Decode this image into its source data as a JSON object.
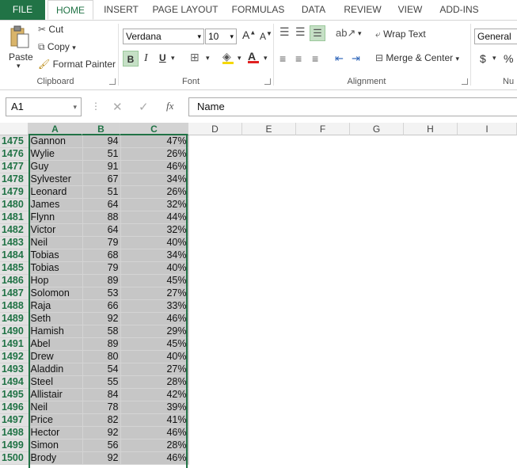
{
  "tabs": [
    "FILE",
    "HOME",
    "INSERT",
    "PAGE LAYOUT",
    "FORMULAS",
    "DATA",
    "REVIEW",
    "VIEW",
    "ADD-INS"
  ],
  "clipboard": {
    "paste": "Paste",
    "cut": "Cut",
    "copy": "Copy",
    "format_painter": "Format Painter",
    "label": "Clipboard"
  },
  "font": {
    "name": "Verdana",
    "size": "10",
    "bold": "B",
    "italic": "I",
    "underline": "U",
    "label": "Font",
    "font_color": "#e02020"
  },
  "alignment": {
    "wrap_text": "Wrap Text",
    "merge_center": "Merge & Center",
    "label": "Alignment"
  },
  "number": {
    "format": "General",
    "currency": "$",
    "percent": "%",
    "label_partial": "Nu"
  },
  "formula_bar": {
    "name_box": "A1",
    "fx": "fx",
    "value": "Name"
  },
  "columns": [
    "A",
    "B",
    "C",
    "D",
    "E",
    "F",
    "G",
    "H",
    "I"
  ],
  "rows": [
    {
      "n": "1475",
      "a": "Gannon",
      "b": "94",
      "c": "47%"
    },
    {
      "n": "1476",
      "a": "Wylie",
      "b": "51",
      "c": "26%"
    },
    {
      "n": "1477",
      "a": "Guy",
      "b": "91",
      "c": "46%"
    },
    {
      "n": "1478",
      "a": "Sylvester",
      "b": "67",
      "c": "34%"
    },
    {
      "n": "1479",
      "a": "Leonard",
      "b": "51",
      "c": "26%"
    },
    {
      "n": "1480",
      "a": "James",
      "b": "64",
      "c": "32%"
    },
    {
      "n": "1481",
      "a": "Flynn",
      "b": "88",
      "c": "44%"
    },
    {
      "n": "1482",
      "a": "Victor",
      "b": "64",
      "c": "32%"
    },
    {
      "n": "1483",
      "a": "Neil",
      "b": "79",
      "c": "40%"
    },
    {
      "n": "1484",
      "a": "Tobias",
      "b": "68",
      "c": "34%"
    },
    {
      "n": "1485",
      "a": "Tobias",
      "b": "79",
      "c": "40%"
    },
    {
      "n": "1486",
      "a": "Hop",
      "b": "89",
      "c": "45%"
    },
    {
      "n": "1487",
      "a": "Solomon",
      "b": "53",
      "c": "27%"
    },
    {
      "n": "1488",
      "a": "Raja",
      "b": "66",
      "c": "33%"
    },
    {
      "n": "1489",
      "a": "Seth",
      "b": "92",
      "c": "46%"
    },
    {
      "n": "1490",
      "a": "Hamish",
      "b": "58",
      "c": "29%"
    },
    {
      "n": "1491",
      "a": "Abel",
      "b": "89",
      "c": "45%"
    },
    {
      "n": "1492",
      "a": "Drew",
      "b": "80",
      "c": "40%"
    },
    {
      "n": "1493",
      "a": "Aladdin",
      "b": "54",
      "c": "27%"
    },
    {
      "n": "1494",
      "a": "Steel",
      "b": "55",
      "c": "28%"
    },
    {
      "n": "1495",
      "a": "Allistair",
      "b": "84",
      "c": "42%"
    },
    {
      "n": "1496",
      "a": "Neil",
      "b": "78",
      "c": "39%"
    },
    {
      "n": "1497",
      "a": "Price",
      "b": "82",
      "c": "41%"
    },
    {
      "n": "1498",
      "a": "Hector",
      "b": "92",
      "c": "46%"
    },
    {
      "n": "1499",
      "a": "Simon",
      "b": "56",
      "c": "28%"
    },
    {
      "n": "1500",
      "a": "Brody",
      "b": "92",
      "c": "46%"
    }
  ],
  "colors": {
    "accent": "#217346",
    "selection": "#c6c6c6"
  }
}
